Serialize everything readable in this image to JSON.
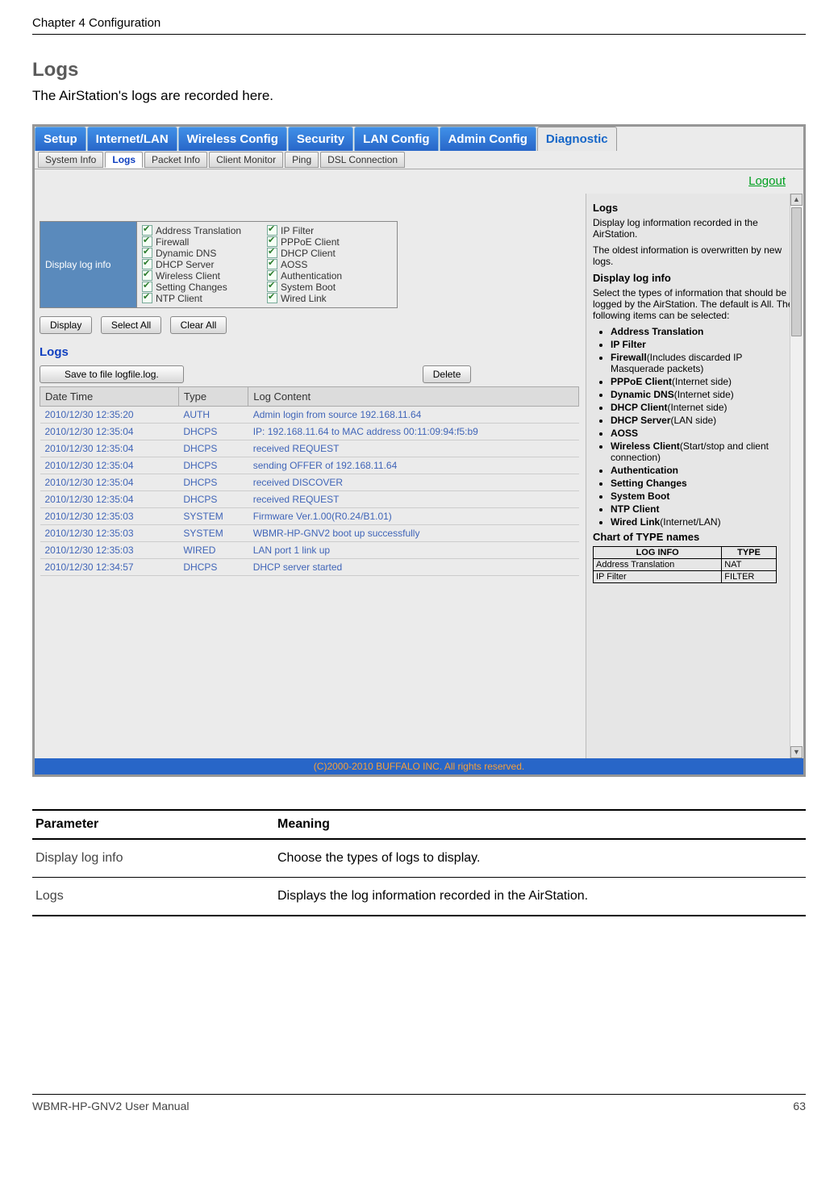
{
  "header": {
    "chapter": "Chapter 4  Configuration"
  },
  "section": {
    "title": "Logs",
    "intro": "The AirStation's logs are recorded here."
  },
  "tabs": {
    "main": [
      "Setup",
      "Internet/LAN",
      "Wireless Config",
      "Security",
      "LAN Config",
      "Admin Config",
      "Diagnostic"
    ],
    "main_active_index": 6,
    "sub": [
      "System Info",
      "Logs",
      "Packet Info",
      "Client Monitor",
      "Ping",
      "DSL Connection"
    ],
    "sub_active_index": 1
  },
  "logout": "Logout",
  "display_log_info": {
    "label": "Display log info",
    "col1": [
      "Address Translation",
      "Firewall",
      "Dynamic DNS",
      "DHCP Server",
      "Wireless Client",
      "Setting Changes",
      "NTP Client"
    ],
    "col2": [
      "IP Filter",
      "PPPoE Client",
      "DHCP Client",
      "AOSS",
      "Authentication",
      "System Boot",
      "Wired Link"
    ]
  },
  "buttons": {
    "display": "Display",
    "select_all": "Select All",
    "clear_all": "Clear All"
  },
  "logs_panel": {
    "heading": "Logs",
    "save_btn": "Save to file logfile.log.",
    "delete_btn": "Delete",
    "columns": [
      "Date Time",
      "Type",
      "Log Content"
    ],
    "rows": [
      {
        "dt": "2010/12/30 12:35:20",
        "type": "AUTH",
        "content": "Admin login from source 192.168.11.64"
      },
      {
        "dt": "2010/12/30 12:35:04",
        "type": "DHCPS",
        "content": "IP: 192.168.11.64 to MAC address 00:11:09:94:f5:b9"
      },
      {
        "dt": "2010/12/30 12:35:04",
        "type": "DHCPS",
        "content": "received REQUEST"
      },
      {
        "dt": "2010/12/30 12:35:04",
        "type": "DHCPS",
        "content": "sending OFFER of 192.168.11.64"
      },
      {
        "dt": "2010/12/30 12:35:04",
        "type": "DHCPS",
        "content": "received DISCOVER"
      },
      {
        "dt": "2010/12/30 12:35:04",
        "type": "DHCPS",
        "content": "received REQUEST"
      },
      {
        "dt": "2010/12/30 12:35:03",
        "type": "SYSTEM",
        "content": "Firmware Ver.1.00(R0.24/B1.01)"
      },
      {
        "dt": "2010/12/30 12:35:03",
        "type": "SYSTEM",
        "content": "WBMR-HP-GNV2 boot up successfully"
      },
      {
        "dt": "2010/12/30 12:35:03",
        "type": "WIRED",
        "content": "LAN port 1 link up"
      },
      {
        "dt": "2010/12/30 12:34:57",
        "type": "DHCPS",
        "content": "DHCP server started"
      }
    ]
  },
  "help": {
    "h1": "Logs",
    "p1": "Display log information recorded in the AirStation.",
    "p2": "The oldest information is overwritten by new logs.",
    "h2": "Display log info",
    "p3": "Select the types of information that should be logged by the AirStation. The default is All. The following items can be selected:",
    "items": [
      {
        "b": "Address Translation",
        "t": ""
      },
      {
        "b": "IP Filter",
        "t": ""
      },
      {
        "b": "Firewall",
        "t": "(Includes discarded IP Masquerade packets)"
      },
      {
        "b": "PPPoE Client",
        "t": "(Internet side)"
      },
      {
        "b": "Dynamic DNS",
        "t": "(Internet side)"
      },
      {
        "b": "DHCP Client",
        "t": "(Internet side)"
      },
      {
        "b": "DHCP Server",
        "t": "(LAN side)"
      },
      {
        "b": "AOSS",
        "t": ""
      },
      {
        "b": "Wireless Client",
        "t": "(Start/stop and client connection)"
      },
      {
        "b": "Authentication",
        "t": ""
      },
      {
        "b": "Setting Changes",
        "t": ""
      },
      {
        "b": "System Boot",
        "t": ""
      },
      {
        "b": "NTP Client",
        "t": ""
      },
      {
        "b": "Wired Link",
        "t": "(Internet/LAN)"
      }
    ],
    "chart_h": "Chart of TYPE names",
    "chart_cols": [
      "LOG INFO",
      "TYPE"
    ],
    "chart_rows": [
      [
        "Address Translation",
        "NAT"
      ],
      [
        "IP Filter",
        "FILTER"
      ]
    ]
  },
  "copyright": "(C)2000-2010 BUFFALO INC. All rights reserved.",
  "param_table": {
    "h1": "Parameter",
    "h2": "Meaning",
    "rows": [
      {
        "p": "Display log info",
        "m": "Choose the types of logs to display."
      },
      {
        "p": "Logs",
        "m": "Displays the log information recorded in the AirStation."
      }
    ]
  },
  "footer": {
    "manual": "WBMR-HP-GNV2 User Manual",
    "page": "63"
  }
}
